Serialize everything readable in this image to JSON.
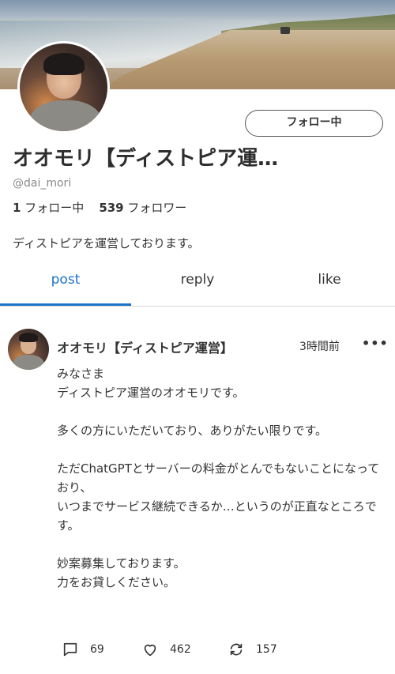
{
  "profile": {
    "display_name": "オオモリ【ディストピア運…",
    "handle": "@dai_mori",
    "following_count": "1",
    "following_label": "フォロー中",
    "followers_count": "539",
    "followers_label": "フォロワー",
    "bio": "ディストピアを運営しております。",
    "follow_button_label": "フォロー中"
  },
  "tabs": [
    {
      "label": "post",
      "active": true
    },
    {
      "label": "reply",
      "active": false
    },
    {
      "label": "like",
      "active": false
    }
  ],
  "post": {
    "author": "オオモリ【ディストピア運営】",
    "time": "3時間前",
    "paragraphs": [
      "みなさま\nディストピア運営のオオモリです。",
      "多くの方にいただいており、ありがたい限りです。",
      "ただChatGPTとサーバーの料金がとんでもないことになっており、\nいつまでサービス継続できるか…というのが正直なところです。",
      "妙案募集しております。\n力をお貸しください。"
    ],
    "reply_count": "69",
    "like_count": "462",
    "repost_count": "157"
  },
  "colors": {
    "accent": "#1a73c8",
    "text": "#333333",
    "muted": "#888888"
  }
}
